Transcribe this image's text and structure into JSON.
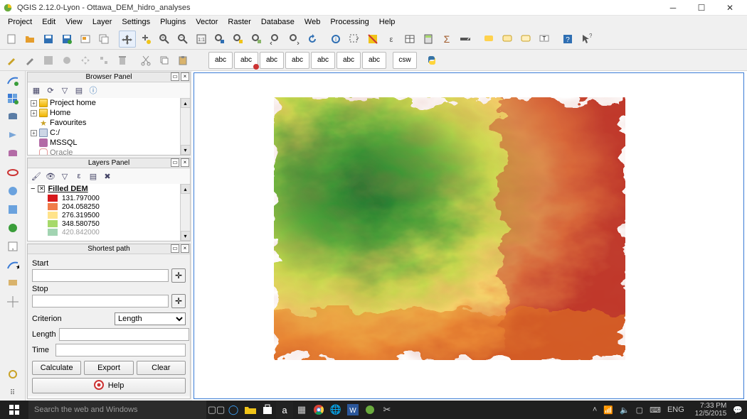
{
  "title": "QGIS 2.12.0-Lyon - Ottawa_DEM_hidro_analyses",
  "menus": [
    "Project",
    "Edit",
    "View",
    "Layer",
    "Settings",
    "Plugins",
    "Vector",
    "Raster",
    "Database",
    "Web",
    "Processing",
    "Help"
  ],
  "panels": {
    "browser": {
      "title": "Browser Panel",
      "items": [
        {
          "label": "Project home",
          "icon": "folder",
          "expand": true
        },
        {
          "label": "Home",
          "icon": "folder",
          "expand": true
        },
        {
          "label": "Favourites",
          "icon": "star",
          "expand": false
        },
        {
          "label": "C:/",
          "icon": "drive",
          "expand": true
        },
        {
          "label": "MSSQL",
          "icon": "db",
          "expand": false
        },
        {
          "label": "Oracle",
          "icon": "db",
          "expand": false
        }
      ]
    },
    "layers": {
      "title": "Layers Panel",
      "layer_name": "Filled DEM",
      "legend": [
        {
          "color": "#d7191c",
          "value": "131.797000"
        },
        {
          "color": "#f07c4a",
          "value": "204.058250"
        },
        {
          "color": "#ffe38b",
          "value": "276.319500"
        },
        {
          "color": "#a6d96a",
          "value": "348.580750"
        },
        {
          "color": "#1a9641",
          "value": "420.842000"
        }
      ]
    },
    "shortest": {
      "title": "Shortest path",
      "labels": {
        "start": "Start",
        "stop": "Stop",
        "criterion": "Criterion",
        "length": "Length",
        "time": "Time"
      },
      "criterion_value": "Length",
      "buttons": {
        "calc": "Calculate",
        "export": "Export",
        "clear": "Clear",
        "help": "Help"
      }
    }
  },
  "taskbar": {
    "search_placeholder": "Search the web and Windows",
    "lang": "ENG",
    "time": "7:33 PM",
    "date": "12/5/2015"
  }
}
